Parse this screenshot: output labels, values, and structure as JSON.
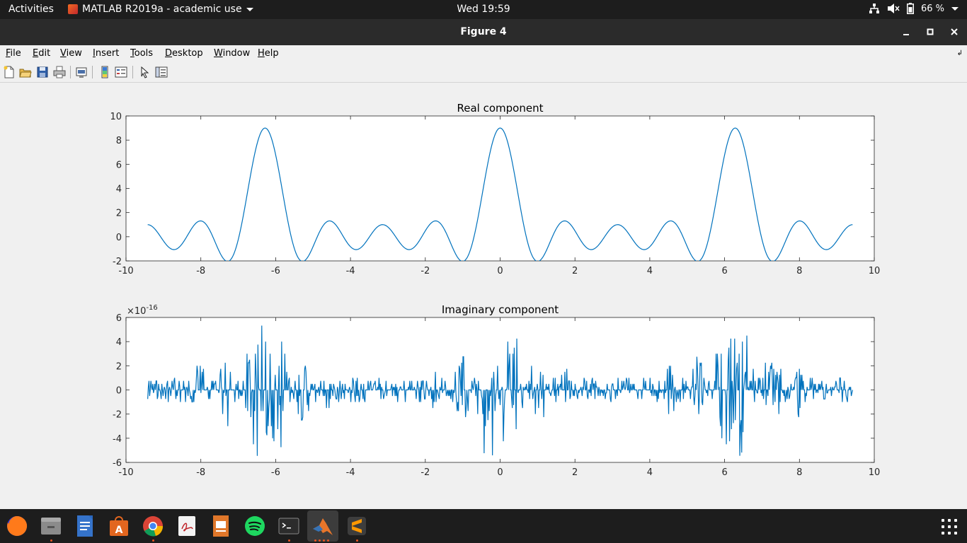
{
  "topbar": {
    "activities": "Activities",
    "app_name": "MATLAB R2019a - academic use",
    "clock": "Wed 19:59",
    "battery": "66 %"
  },
  "window": {
    "title": "Figure 4"
  },
  "menu": {
    "items": [
      "File",
      "Edit",
      "View",
      "Insert",
      "Tools",
      "Desktop",
      "Window",
      "Help"
    ],
    "mnemonics": [
      "F",
      "E",
      "V",
      "I",
      "T",
      "D",
      "W",
      "H"
    ]
  },
  "toolbar": {
    "icons": [
      "new-figure-icon",
      "open-file-icon",
      "save-icon",
      "print-icon",
      "link-plot-icon",
      "insert-colorbar-icon",
      "insert-legend-icon",
      "edit-plot-icon",
      "property-inspector-icon"
    ]
  },
  "colors": {
    "line": "#0072bd",
    "axes": "#262626"
  },
  "chart_data": [
    {
      "type": "line",
      "title": "Real component",
      "xlabel": "",
      "ylabel": "",
      "xlim": [
        -10,
        10
      ],
      "ylim": [
        -2,
        10
      ],
      "xticks": [
        -10,
        -8,
        -6,
        -4,
        -2,
        0,
        2,
        4,
        6,
        8,
        10
      ],
      "yticks": [
        -2,
        0,
        2,
        4,
        6,
        8,
        10
      ],
      "x_range": [
        -9.42,
        9.42
      ],
      "series": [
        {
          "formula": "1 + 2cos(x) + 2cos(2x) + 2cos(3x) + 2cos(4x)",
          "peaks": [
            [
              -6.28,
              9
            ],
            [
              0,
              9
            ],
            [
              6.28,
              9
            ]
          ],
          "start_end_value": 1
        }
      ],
      "grid": false
    },
    {
      "type": "line",
      "title": "Imaginary component",
      "xlabel": "",
      "ylabel": "",
      "exponent_label": "×10",
      "exponent": "-16",
      "xlim": [
        -10,
        10
      ],
      "ylim": [
        -6,
        6
      ],
      "xticks": [
        -10,
        -8,
        -6,
        -4,
        -2,
        0,
        2,
        4,
        6,
        8,
        10
      ],
      "yticks": [
        -6,
        -4,
        -2,
        0,
        2,
        4,
        6
      ],
      "x_range": [
        -9.42,
        9.42
      ],
      "series": [
        {
          "description_values": "numerical noise around 0, amplitude up to about ±5.5e-16, largest near x = ±6.3 and x = 0"
        }
      ],
      "grid": false
    }
  ],
  "dock": {
    "apps": [
      "firefox-icon",
      "files-icon",
      "writer-icon",
      "software-center-icon",
      "chrome-icon",
      "document-viewer-icon",
      "impress-icon",
      "spotify-icon",
      "terminal-icon",
      "matlab-icon",
      "sublime-text-icon"
    ]
  }
}
